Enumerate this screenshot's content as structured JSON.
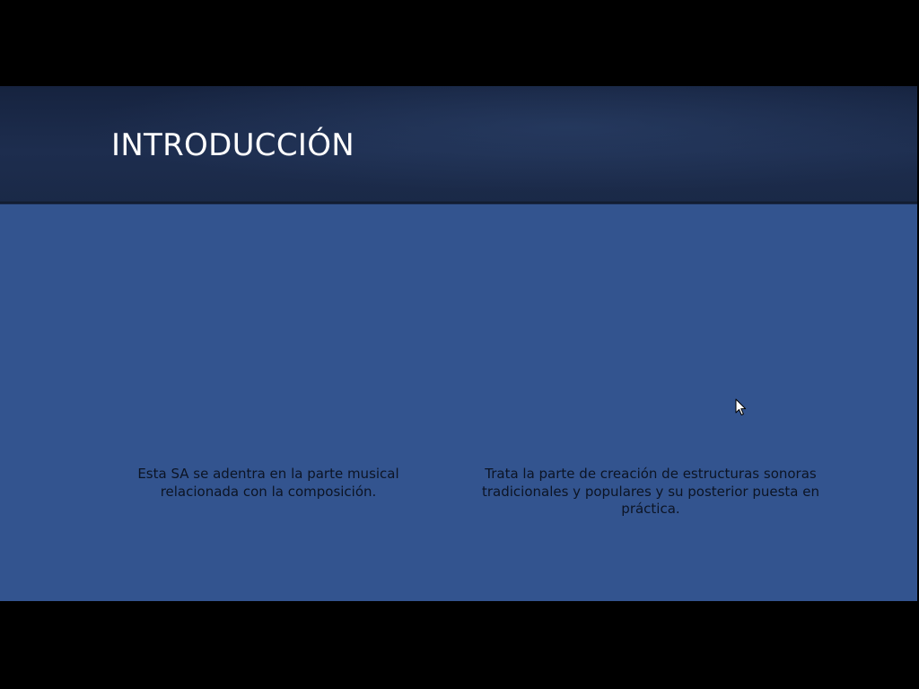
{
  "slide": {
    "title": "INTRODUCCIÓN",
    "left_text": "Esta SA se adentra en la parte musical relacionada con la composición.",
    "right_text": "Trata la parte de creación de estructuras sonoras tradicionales y populares y su posterior puesta en práctica."
  },
  "colors": {
    "screen_background": "#000000",
    "slide_background": "#33548f",
    "title_band": "#1a2947",
    "title_text": "#ffffff",
    "body_text": "#0c1424"
  },
  "icons": {
    "cursor": "mouse-pointer-arrow"
  }
}
